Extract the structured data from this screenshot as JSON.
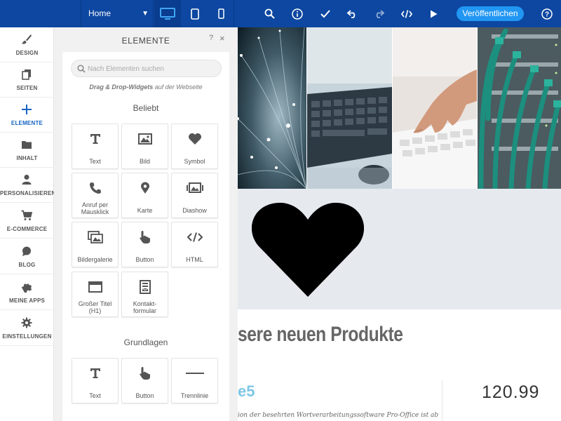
{
  "topbar": {
    "page_selector": "Home",
    "device_desktop_icon": "desktop-icon",
    "device_tablet_icon": "tablet-icon",
    "device_mobile_icon": "smartphone-icon",
    "publish_label": "Veröffentlichen",
    "colors": {
      "bar": "#0d47a1",
      "publish": "#2196f3"
    }
  },
  "leftnav": {
    "items": [
      {
        "label": "DESIGN",
        "icon": "brush-icon"
      },
      {
        "label": "SEITEN",
        "icon": "pages-icon"
      },
      {
        "label": "ELEMENTE",
        "icon": "plus-icon",
        "active": true
      },
      {
        "label": "INHALT",
        "icon": "folder-icon"
      },
      {
        "label": "PERSONALISIEREN",
        "icon": "person-icon"
      },
      {
        "label": "E-COMMERCE",
        "icon": "cart-icon"
      },
      {
        "label": "BLOG",
        "icon": "speech-bubble-icon"
      },
      {
        "label": "MEINE APPS",
        "icon": "puzzle-icon"
      },
      {
        "label": "EINSTELLUNGEN",
        "icon": "gear-icon"
      }
    ]
  },
  "panel": {
    "title": "ELEMENTE",
    "help": "?",
    "close": "×",
    "search_placeholder": "Nach Elementen suchen",
    "hint_bold": "Drag & Drop-Widgets",
    "hint_rest": " auf der Webseite",
    "popular_title": "Beliebt",
    "popular": [
      {
        "label": "Text",
        "icon": "text-icon"
      },
      {
        "label": "Bild",
        "icon": "image-icon"
      },
      {
        "label": "Symbol",
        "icon": "heart-icon"
      },
      {
        "label": "Anruf per Mausklick",
        "icon": "phone-icon"
      },
      {
        "label": "Karte",
        "icon": "map-pin-icon"
      },
      {
        "label": "Diashow",
        "icon": "slideshow-icon"
      },
      {
        "label": "Bildergalerie",
        "icon": "gallery-icon"
      },
      {
        "label": "Button",
        "icon": "pointer-hand-icon"
      },
      {
        "label": "HTML",
        "icon": "code-icon"
      },
      {
        "label": "Großer Titel (H1)",
        "icon": "title-icon"
      },
      {
        "label": "Kontakt-formular",
        "icon": "form-icon"
      }
    ],
    "basics_title": "Grundlagen",
    "basics": [
      {
        "label": "Text",
        "icon": "text-icon"
      },
      {
        "label": "Button",
        "icon": "pointer-hand-icon"
      },
      {
        "label": "Trennlinie",
        "icon": "divider-icon"
      }
    ]
  },
  "canvas": {
    "hero_images": [
      "fiber-optics-image",
      "keyboard-mouse-image",
      "typing-hands-image",
      "network-cables-image"
    ],
    "heart_symbol": "heart-icon",
    "heading": "sere neuen Produkte",
    "accent_text": "e5",
    "price": "120.99",
    "description_snippet": "ion der besehrten Wortverarbeitungssoftware Pro-Office ist ab"
  }
}
